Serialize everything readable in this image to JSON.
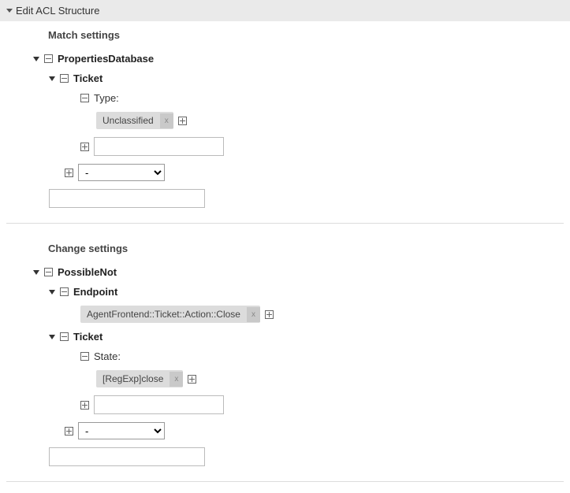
{
  "header": {
    "title": "Edit ACL Structure"
  },
  "match": {
    "title": "Match settings",
    "root": "PropertiesDatabase",
    "ticket": {
      "label": "Ticket",
      "type": {
        "label": "Type:",
        "value": "Unclassified"
      }
    },
    "select_default": "-"
  },
  "change": {
    "title": "Change settings",
    "root": "PossibleNot",
    "endpoint": {
      "label": "Endpoint",
      "value": "AgentFrontend::Ticket::Action::Close"
    },
    "ticket": {
      "label": "Ticket",
      "state": {
        "label": "State:",
        "value": "[RegExp]close"
      }
    },
    "select_default": "-"
  }
}
